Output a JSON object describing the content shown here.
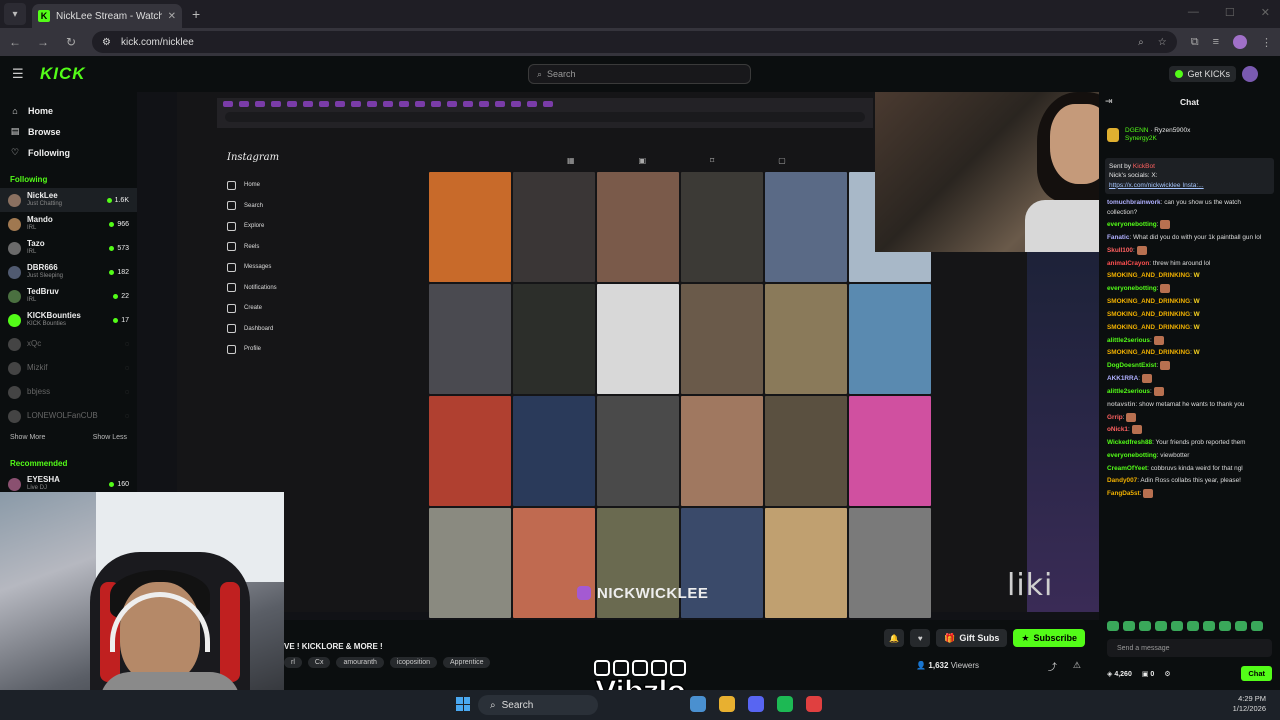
{
  "browser": {
    "tab_title": "NickLee Stream - Watch Li...",
    "url": "kick.com/nicklee"
  },
  "kick": {
    "logo": "KICK",
    "search_placeholder": "Search",
    "get_kicks": "Get KICKs",
    "accent": "#53fc18"
  },
  "sidebar": {
    "nav": [
      {
        "label": "Home",
        "icon": "home-icon"
      },
      {
        "label": "Browse",
        "icon": "browse-icon"
      },
      {
        "label": "Following",
        "icon": "heart-icon"
      }
    ],
    "following_title": "Following",
    "following": [
      {
        "name": "NickLee",
        "category": "Just Chatting",
        "viewers": "1.6K",
        "color": "#8a7060",
        "online": true
      },
      {
        "name": "Mando",
        "category": "IRL",
        "viewers": "966",
        "color": "#a07850",
        "online": true
      },
      {
        "name": "Tazo",
        "category": "IRL",
        "viewers": "573",
        "color": "#6a6a6a",
        "online": true
      },
      {
        "name": "DBR666",
        "category": "Just Sleeping",
        "viewers": "182",
        "color": "#505a70",
        "online": true
      },
      {
        "name": "TedBruv",
        "category": "IRL",
        "viewers": "22",
        "color": "#4a7040",
        "online": true
      },
      {
        "name": "KICKBounties",
        "category": "KICK Bounties",
        "viewers": "17",
        "color": "#53fc18",
        "online": true
      },
      {
        "name": "xQc",
        "category": "",
        "viewers": "",
        "color": "#444",
        "online": false
      },
      {
        "name": "Mizkif",
        "category": "",
        "viewers": "",
        "color": "#444",
        "online": false
      },
      {
        "name": "bbjess",
        "category": "",
        "viewers": "",
        "color": "#444",
        "online": false
      },
      {
        "name": "LONEWOLFanCUB",
        "category": "",
        "viewers": "",
        "color": "#444",
        "online": false
      }
    ],
    "show_more": "Show More",
    "show_less": "Show Less",
    "recommended_title": "Recommended",
    "recommended": [
      {
        "name": "EYESHA",
        "category": "Live DJ",
        "viewers": "160",
        "color": "#8a5070"
      }
    ]
  },
  "stream": {
    "instagram_label": "Instagram",
    "ig_nav": [
      "Home",
      "Search",
      "Explore",
      "Reels",
      "Messages",
      "Notifications",
      "Create",
      "Dashboard",
      "Profile"
    ],
    "banner_text": "NICKWICKLEE",
    "overlay_text": "liki",
    "grid_colors": [
      "#c86a2a",
      "#3a3636",
      "#7a5a4a",
      "#3c3a36",
      "#5a6a86",
      "#a8b8c8",
      "#4a4a50",
      "#2c2e2a",
      "#d8d8d8",
      "#6a5a4a",
      "#8a7a5a",
      "#5a8ab0",
      "#b04030",
      "#2a3a5a",
      "#4a4a4a",
      "#a07860",
      "#5a5040",
      "#d050a0",
      "#8a8a80",
      "#c06a50",
      "#6a6a50",
      "#3a4a6a",
      "#c0a070",
      "#7a7a7a"
    ]
  },
  "info": {
    "title": "VE ! KICKLORE & MORE !",
    "tags": [
      "rl",
      "Cx",
      "amouranth",
      "icoposition",
      "Apprentice"
    ],
    "gift_subs": "Gift Subs",
    "subscribe": "Subscribe",
    "viewers_count": "1,632",
    "viewers_label": "Viewers"
  },
  "chat": {
    "title": "Chat",
    "pinned_user1": "DGENN",
    "pinned_user2": "Ryzen5900x",
    "pinned_user3": "Synergy2K",
    "sent_by_label": "Sent by",
    "sent_by_user": "KickBot",
    "socials_line": "Nick's socials: X:",
    "socials_link": "https://x.com/nickwicklee Insta:...",
    "messages": [
      {
        "user": "tomuchbrainwork",
        "color": "#b0b0ff",
        "text": "can you show us the watch collection?"
      },
      {
        "user": "everyonebotting",
        "color": "#53fc18",
        "text": "",
        "emote": true
      },
      {
        "user": "Fanatic",
        "color": "#b0b0ff",
        "text": "What did you do with your 1k paintball gun lol"
      },
      {
        "user": "Skull100",
        "color": "#ff6060",
        "text": "",
        "emote": true
      },
      {
        "user": "animalCrayon",
        "color": "#ff5050",
        "text": "threw him around lol"
      },
      {
        "user": "SMOKING_AND_DRINKING",
        "color": "#f0b000",
        "text": "",
        "w": true
      },
      {
        "user": "everyonebotting",
        "color": "#53fc18",
        "text": "",
        "emote": true
      },
      {
        "user": "SMOKING_AND_DRINKING",
        "color": "#f0b000",
        "text": "",
        "w": true
      },
      {
        "user": "SMOKING_AND_DRINKING",
        "color": "#f0b000",
        "text": "",
        "w": true
      },
      {
        "user": "SMOKING_AND_DRINKING",
        "color": "#f0b000",
        "text": "",
        "w": true
      },
      {
        "user": "alittle2serious",
        "color": "#53fc18",
        "text": "",
        "emote": true
      },
      {
        "user": "SMOKING_AND_DRINKING",
        "color": "#f0b000",
        "text": "",
        "w": true
      },
      {
        "user": "DogDoesntExist",
        "color": "#53fc18",
        "text": "",
        "emote": true
      },
      {
        "user": "AKK1RRA",
        "color": "#b0b0ff",
        "text": "",
        "emote": true
      },
      {
        "user": "alittle2serious",
        "color": "#53fc18",
        "text": "",
        "emote": true
      },
      {
        "user": "notavstin",
        "color": "#aaaaaa",
        "text": "show metamat he wants to thank you"
      },
      {
        "user": "Grrip",
        "color": "#ff6060",
        "text": "",
        "emote": true
      },
      {
        "user": "oNick1",
        "color": "#ff6060",
        "text": "",
        "emote": true
      },
      {
        "user": "Wickedfresh88",
        "color": "#53fc18",
        "text": "Your friends prob reported them"
      },
      {
        "user": "everyonebotting",
        "color": "#53fc18",
        "text": "viewbotter"
      },
      {
        "user": "CreamOfYeet",
        "color": "#53fc18",
        "text": "cobbruvs kinda weird for that ngl"
      },
      {
        "user": "Dandy007",
        "color": "#f0b000",
        "text": "Adin Ross collabs this year, please!"
      },
      {
        "user": "FangDa5st",
        "color": "#f0b000",
        "text": "",
        "emote": true
      }
    ],
    "input_placeholder": "Send a message",
    "points": "4,260",
    "count": "0",
    "chat_button": "Chat"
  },
  "watermark": "Vibzlo",
  "taskbar": {
    "search_label": "Search",
    "time": "4:29 PM",
    "date": "1/12/2026"
  }
}
